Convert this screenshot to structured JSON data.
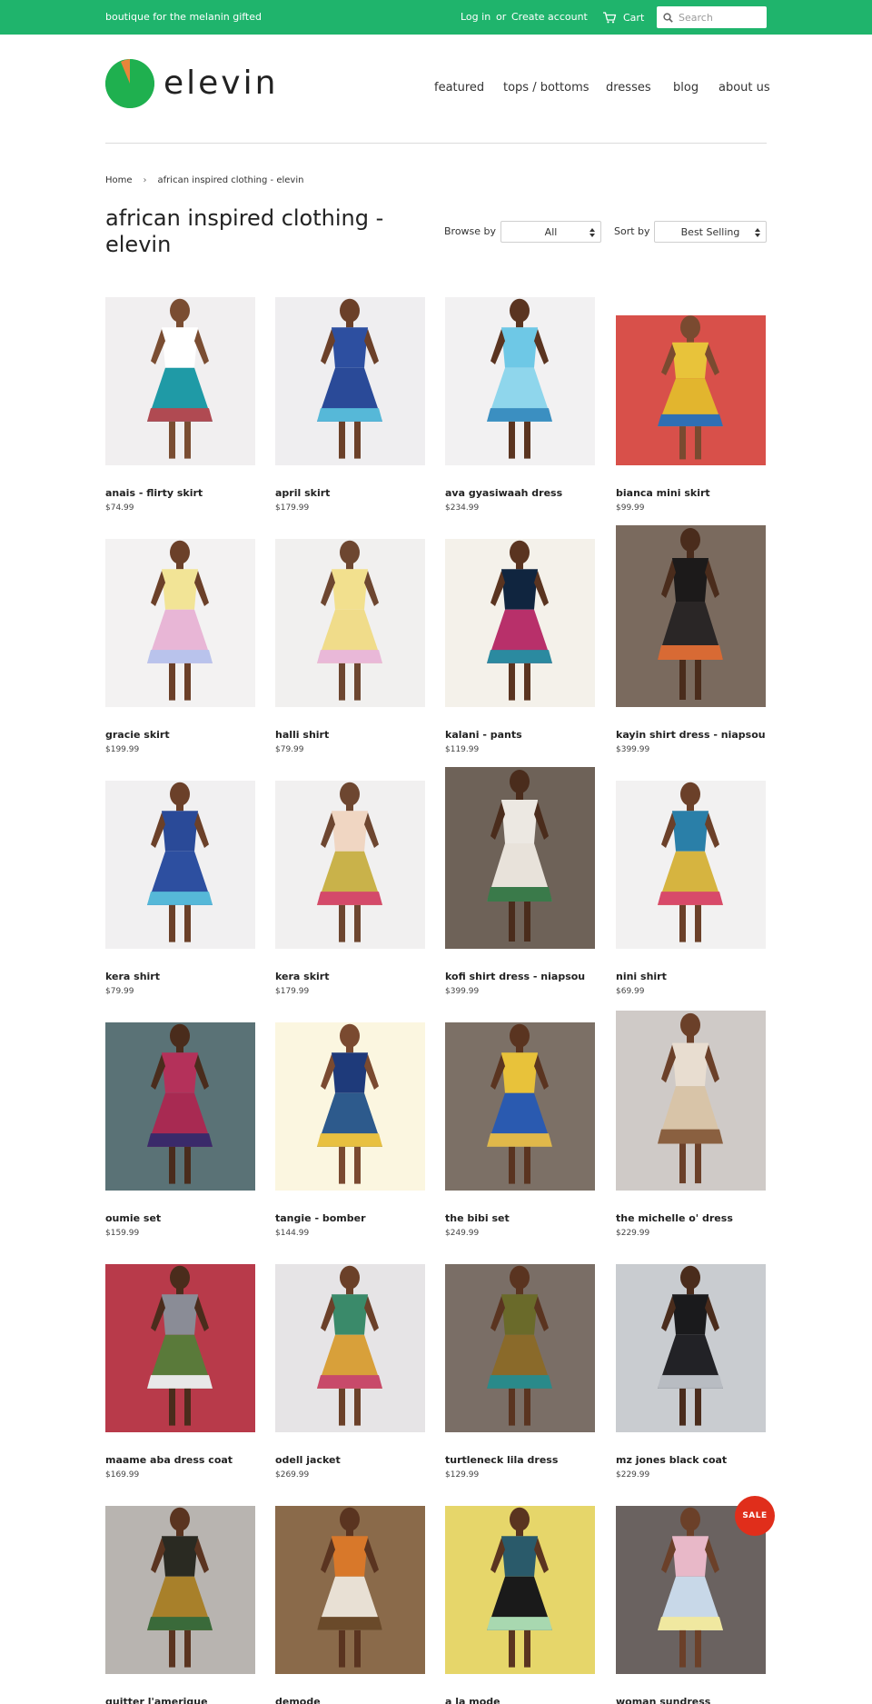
{
  "topbar": {
    "tagline": "boutique for the melanin gifted",
    "login": "Log in",
    "or": "or",
    "create_account": "Create account",
    "cart": "Cart",
    "search_placeholder": "Search"
  },
  "brand": {
    "name": "elevin",
    "colors": {
      "green": "#1fb46c",
      "logo_green": "#1fb04f",
      "logo_orange": "#e8853a",
      "sale_red": "#e02e1b"
    }
  },
  "nav": [
    "featured",
    "tops / bottoms",
    "dresses",
    "blog",
    "about us"
  ],
  "breadcrumb": {
    "home": "Home",
    "current": "african inspired clothing - elevin"
  },
  "collection": {
    "title": "african inspired clothing - elevin",
    "browse_label": "Browse by",
    "browse_value": "All",
    "sort_label": "Sort by",
    "sort_value": "Best Selling"
  },
  "products": [
    {
      "name": "anais - flirty skirt",
      "price": "$74.99",
      "bg": "#f1eff0",
      "top": "#ffffff",
      "bottom": "#1f9aa6",
      "accent": "#b04a52",
      "skin": "#7a4d32"
    },
    {
      "name": "april skirt",
      "price": "$179.99",
      "bg": "#efeef0",
      "top": "#2d4fa0",
      "bottom": "#2a4a98",
      "accent": "#56b8d8",
      "skin": "#6b4029"
    },
    {
      "name": "ava gyasiwaah dress",
      "price": "$234.99",
      "bg": "#f2f1f2",
      "top": "#6ec8e6",
      "bottom": "#8fd6ec",
      "accent": "#3b8fc1",
      "skin": "#5a3420"
    },
    {
      "name": "bianca mini skirt",
      "price": "$99.99",
      "bg": "#d8504a",
      "top": "#e8c33a",
      "bottom": "#e2b52e",
      "accent": "#2f6fb4",
      "skin": "#7a4a30"
    },
    {
      "name": "gracie skirt",
      "price": "$199.99",
      "bg": "#f3f2f2",
      "top": "#f2e496",
      "bottom": "#e8b6d6",
      "accent": "#b9c3ec",
      "skin": "#6b4029"
    },
    {
      "name": "halli shirt",
      "price": "$79.99",
      "bg": "#f1f0ef",
      "top": "#f2e08e",
      "bottom": "#f0dc8a",
      "accent": "#e9b8d8",
      "skin": "#6d4630"
    },
    {
      "name": "kalani - pants",
      "price": "$119.99",
      "bg": "#f4f1ea",
      "top": "#10253f",
      "bottom": "#b8306a",
      "accent": "#2b8aa0",
      "skin": "#5a3420"
    },
    {
      "name": "kayin shirt dress - niapsou",
      "price": "$399.99",
      "bg": "#7a6a5e",
      "top": "#1c1a1a",
      "bottom": "#2a2626",
      "accent": "#d86a34",
      "skin": "#4a2c1c"
    },
    {
      "name": "kera shirt",
      "price": "$79.99",
      "bg": "#f1f0f1",
      "top": "#2a4a98",
      "bottom": "#2d4fa0",
      "accent": "#56b8d8",
      "skin": "#6b4029"
    },
    {
      "name": "kera skirt",
      "price": "$179.99",
      "bg": "#f1f0f0",
      "top": "#f0d6c2",
      "bottom": "#c9b24a",
      "accent": "#d44a6a",
      "skin": "#6d4630"
    },
    {
      "name": "kofi shirt dress - niapsou",
      "price": "$399.99",
      "bg": "#6e6258",
      "top": "#ece8e2",
      "bottom": "#e8e2da",
      "accent": "#3a7a4a",
      "skin": "#4a2c1c"
    },
    {
      "name": "nini shirt",
      "price": "$69.99",
      "bg": "#f2f1f1",
      "top": "#2a7fa8",
      "bottom": "#d6b440",
      "accent": "#d84a6a",
      "skin": "#6b4029"
    },
    {
      "name": "oumie set",
      "price": "$159.99",
      "bg": "#5a7276",
      "top": "#b4315a",
      "bottom": "#a82a52",
      "accent": "#3a2a6a",
      "skin": "#4a2c1c"
    },
    {
      "name": "tangie - bomber",
      "price": "$144.99",
      "bg": "#fbf6e0",
      "top": "#1e3a7a",
      "bottom": "#2d5a8c",
      "accent": "#e8c040",
      "skin": "#7a4a30"
    },
    {
      "name": "the bibi set",
      "price": "$249.99",
      "bg": "#7c7066",
      "top": "#e8c23a",
      "bottom": "#2a5ab0",
      "accent": "#e0b84a",
      "skin": "#5a3420"
    },
    {
      "name": "the michelle o' dress",
      "price": "$229.99",
      "bg": "#cfcac7",
      "top": "#e8ddd0",
      "bottom": "#d8c4a8",
      "accent": "#8a6040",
      "skin": "#6b4029"
    },
    {
      "name": "maame aba dress coat",
      "price": "$169.99",
      "bg": "#b83a4a",
      "top": "#8a8c96",
      "bottom": "#5a7a3a",
      "accent": "#e8e8e8",
      "skin": "#4a2c1c"
    },
    {
      "name": "odell jacket",
      "price": "$269.99",
      "bg": "#e6e4e6",
      "top": "#3a8a6a",
      "bottom": "#d8a03a",
      "accent": "#c84a6a",
      "skin": "#6b4029"
    },
    {
      "name": "turtleneck lila dress",
      "price": "$129.99",
      "bg": "#7a6e66",
      "top": "#6a6a2a",
      "bottom": "#8a6a2a",
      "accent": "#2a8a8a",
      "skin": "#5a3420"
    },
    {
      "name": "mz jones black coat",
      "price": "$229.99",
      "bg": "#c9ccd0",
      "top": "#1a1a1c",
      "bottom": "#222226",
      "accent": "#b8bcc2",
      "skin": "#4a2c1c"
    },
    {
      "name": "quitter l'amerique",
      "price": "",
      "bg": "#b8b4b0",
      "top": "#2a2a22",
      "bottom": "#a8802a",
      "accent": "#3a6a3a",
      "skin": "#5a3420"
    },
    {
      "name": "demode",
      "price": "",
      "bg": "#8a6a4a",
      "top": "#d8782a",
      "bottom": "#e8e0d4",
      "accent": "#6a4a2a",
      "skin": "#5a3420"
    },
    {
      "name": "a la mode",
      "price": "",
      "bg": "#e6d66a",
      "top": "#2a5a6a",
      "bottom": "#1a1a1a",
      "accent": "#a8d8b0",
      "skin": "#5a3420"
    },
    {
      "name": "woman sundress",
      "price": "",
      "bg": "#6a6260",
      "top": "#e8b8c8",
      "bottom": "#c8d8e8",
      "accent": "#f0e8a0",
      "skin": "#6b4029"
    }
  ],
  "sale_badge": "SALE"
}
